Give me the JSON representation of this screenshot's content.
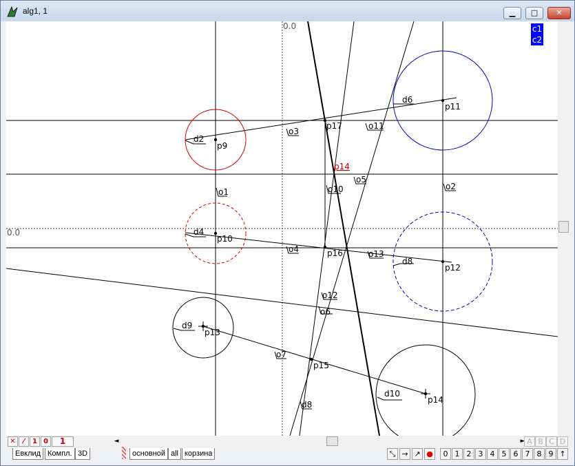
{
  "window": {
    "title": "alg1, 1",
    "minimize": "▁",
    "maximize": "□",
    "close": "✕"
  },
  "legend": [
    "c1",
    "c2"
  ],
  "axes": {
    "top_zero": "0.0",
    "left_zero": "0.0"
  },
  "labels": {
    "d2": "d2",
    "p9": "p9",
    "o3": "o3",
    "p17": "p17",
    "o11": "o11",
    "d6": "d6",
    "p11": "p11",
    "p14_red": "p14",
    "o10": "o10",
    "o5": "o5",
    "o1": "o1",
    "o2": "o2",
    "d4": "d4",
    "p10": "p10",
    "o4": "o4",
    "p16": "p16",
    "o13": "o13",
    "d8": "d8",
    "p12": "p12",
    "o12": "o12",
    "o6": "o6",
    "o8": "o8",
    "d9": "d9",
    "p13": "p13",
    "o7": "o7",
    "p15": "p15",
    "d10": "d10",
    "p14": "p14",
    "d8b": "d8"
  },
  "status_mini": [
    "✕",
    "⁄",
    "1",
    "0"
  ],
  "status_num": "1",
  "scroll_arrows": {
    "left": "◄",
    "right": "►"
  },
  "grey_buttons": [
    "A",
    "B",
    "C",
    "D"
  ],
  "tabs_left": [
    "Евклид",
    "Компл.",
    "3D"
  ],
  "tabs_right": [
    "основной",
    "all",
    "корзина"
  ],
  "tool_buttons": [
    "⤡",
    "→",
    "↗",
    "●"
  ],
  "digit_buttons": [
    "0",
    "1",
    "2",
    "3",
    "4",
    "5",
    "6",
    "7",
    "8",
    "9",
    "↑"
  ]
}
